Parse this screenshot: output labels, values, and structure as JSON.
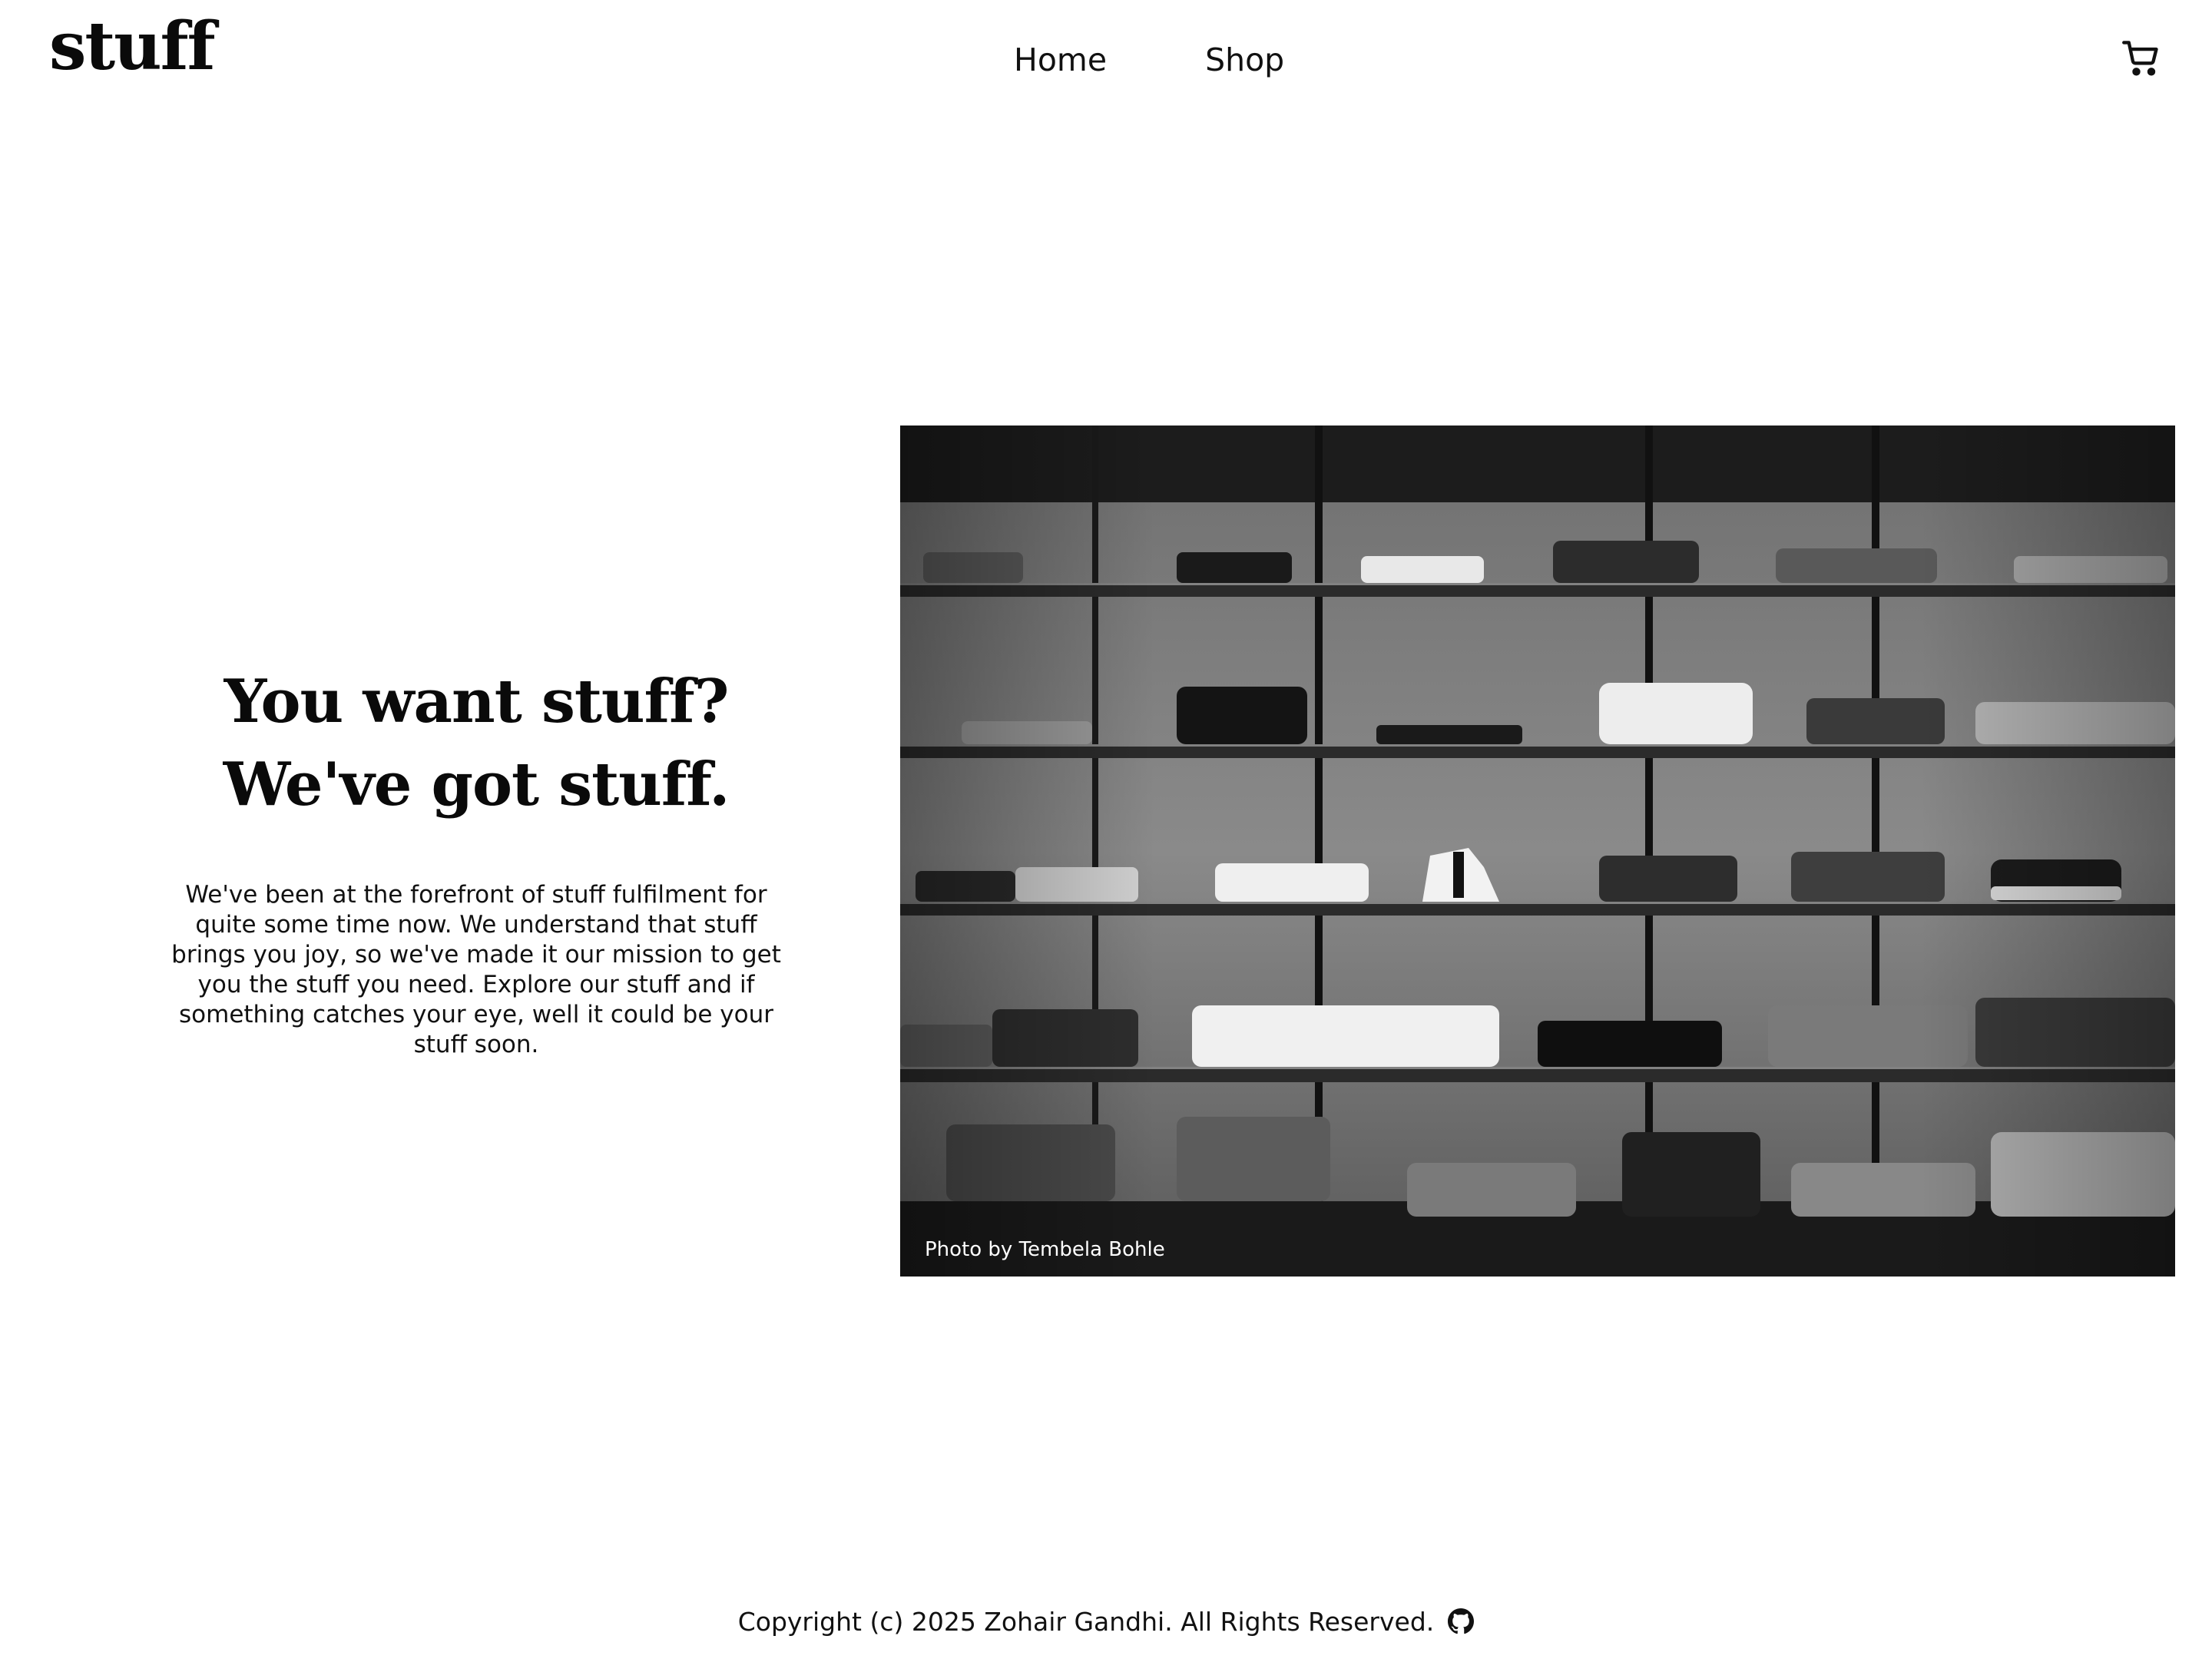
{
  "header": {
    "logo": "stuff",
    "nav": [
      {
        "label": "Home"
      },
      {
        "label": "Shop"
      }
    ],
    "cart_icon": "shopping-cart-icon"
  },
  "hero": {
    "title_line1": "You want stuff?",
    "title_line2": "We've got stuff.",
    "body": "We've been at the forefront of stuff fulfilment for quite some time now. We understand that stuff brings you joy, so we've made it our mission to get you the stuff you need. Explore our stuff and if something catches your eye, well it could be your stuff soon.",
    "photo_credit": "Photo by Tembela Bohle"
  },
  "footer": {
    "copyright": "Copyright (c) 2025 Zohair Gandhi. All Rights Reserved.",
    "github_icon": "github-icon"
  },
  "colors": {
    "background": "#ffffff",
    "text": "#111111"
  }
}
